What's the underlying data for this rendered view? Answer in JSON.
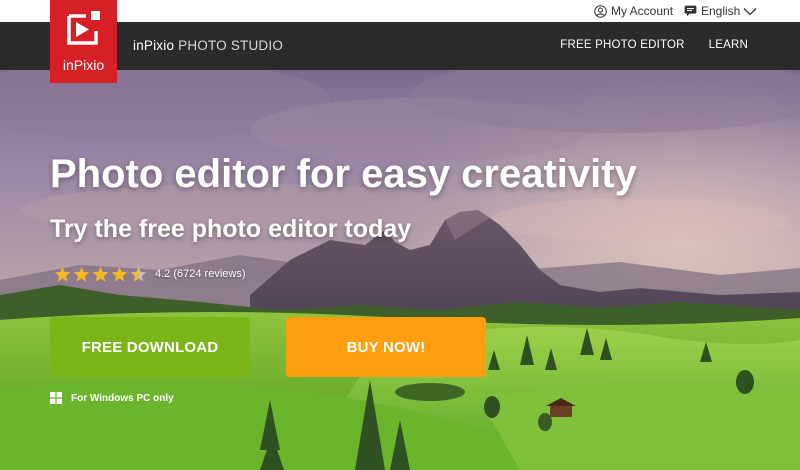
{
  "topbar": {
    "account_label": "My Account",
    "language_label": "English"
  },
  "brand": {
    "logo_text": "inPixio",
    "name_part1": "inPixio",
    "name_part2": "PHOTO STUDIO"
  },
  "nav": {
    "items": [
      "FREE PHOTO EDITOR",
      "LEARN"
    ]
  },
  "hero": {
    "title": "Photo editor for easy creativity",
    "subtitle": "Try the free photo editor today",
    "rating_value": 4.2,
    "rating_max": 5,
    "rating_text": "4.2 (6724 reviews)",
    "download_label": "FREE DOWNLOAD",
    "buy_label": "BUY NOW!",
    "platform_label": "For Windows PC only"
  },
  "colors": {
    "brand_red": "#d71f26",
    "nav_bg": "#2b2b2b",
    "download_green": "#7cb518",
    "buy_orange": "#ff9e0f",
    "star_yellow": "#f5b823"
  },
  "icons": {
    "account": "user-circle-icon",
    "language": "speech-bubble-icon",
    "chevron": "chevron-down-icon",
    "star": "star-icon",
    "windows": "windows-icon",
    "logo_mark": "play-frame-icon"
  }
}
